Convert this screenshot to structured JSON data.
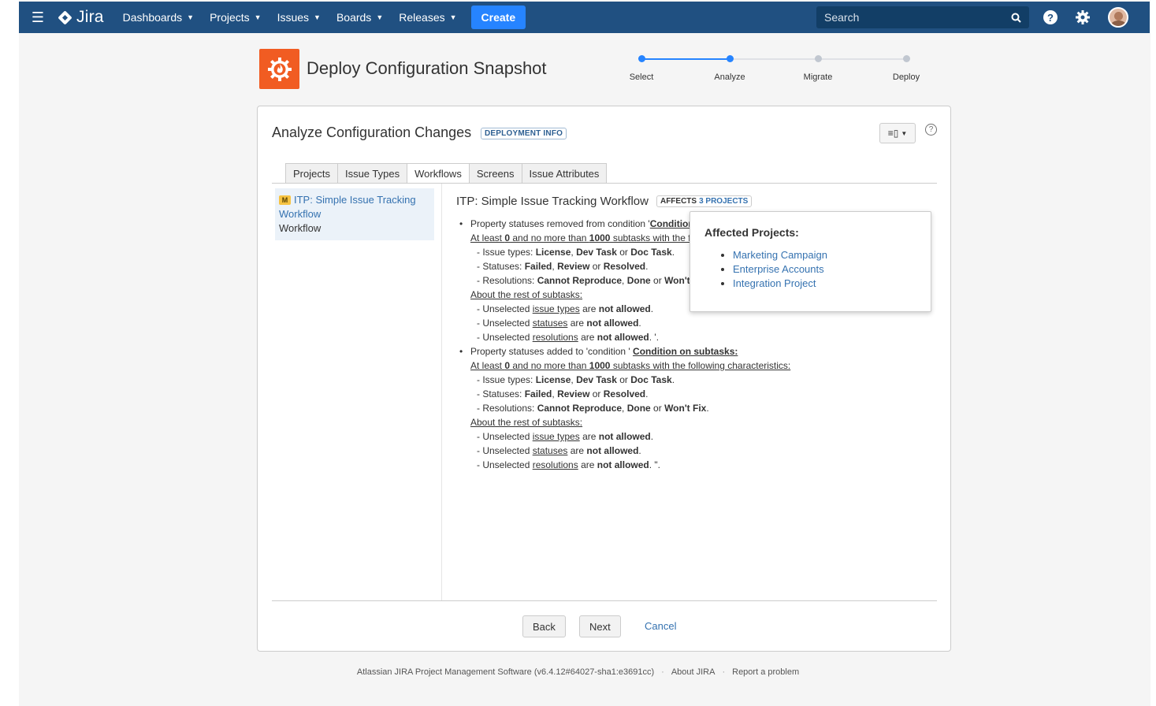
{
  "nav": {
    "logo_text": "Jira",
    "items": [
      {
        "label": "Dashboards"
      },
      {
        "label": "Projects"
      },
      {
        "label": "Issues"
      },
      {
        "label": "Boards"
      },
      {
        "label": "Releases"
      }
    ],
    "create_label": "Create",
    "search_placeholder": "Search"
  },
  "header": {
    "title": "Deploy Configuration Snapshot",
    "steps": [
      "Select",
      "Analyze",
      "Migrate",
      "Deploy"
    ],
    "current_step": 2
  },
  "panel": {
    "title": "Analyze Configuration Changes",
    "badge": "DEPLOYMENT INFO",
    "tabs": [
      "Projects",
      "Issue Types",
      "Workflows",
      "Screens",
      "Issue Attributes"
    ],
    "active_tab": "Workflows",
    "sidebar": {
      "badge": "M",
      "link": "ITP: Simple Issue Tracking Workflow",
      "type": "Workflow"
    },
    "workflow_title": "ITP: Simple Issue Tracking Workflow",
    "affects_label": "AFFECTS",
    "affects_count": "3 PROJECTS",
    "removed": {
      "prefix": "Property statuses removed from condition '",
      "cond": "Condition on subtasks:",
      "atleast_a": "At least ",
      "atleast_min": "0",
      "atleast_b": " and no more than ",
      "atleast_max": "1000",
      "atleast_c": " subtasks with the following characteristics:",
      "issue_types_label": "- Issue types: ",
      "it1": "License",
      "it_sep1": ", ",
      "it2": "Dev Task",
      "it_or": " or ",
      "it3": "Doc Task",
      "it_end": ".",
      "statuses_label": "- Statuses: ",
      "st1": "Failed",
      "st_sep1": ", ",
      "st2": "Review",
      "st_or": " or ",
      "st3": "Resolved",
      "st_end": ".",
      "resolutions_label": "- Resolutions: ",
      "rs1": "Cannot Reproduce",
      "rs_sep1": ", ",
      "rs2": "Done",
      "rs_or": " or ",
      "rs3": "Won't Fix",
      "rs_end": ".",
      "rest_label": "About the rest of subtasks:",
      "u_prefix": "- Unselected ",
      "u_issue_types": "issue types",
      "u_statuses": "statuses",
      "u_resolutions": "resolutions",
      "are": " are ",
      "not_allowed": "not allowed",
      "end1": ".",
      "end_last": ". '."
    },
    "added": {
      "prefix": "Property statuses added to 'condition ' ",
      "end_last": ". \"."
    },
    "buttons": {
      "back": "Back",
      "next": "Next",
      "cancel": "Cancel"
    }
  },
  "popover": {
    "title": "Affected Projects:",
    "projects": [
      "Marketing Campaign",
      "Enterprise Accounts",
      "Integration Project"
    ]
  },
  "footer": {
    "software": "Atlassian JIRA Project Management Software (v6.4.12#64027-sha1:e3691cc)",
    "about": "About JIRA",
    "report": "Report a problem"
  },
  "colors": {
    "nav_bg": "#205081",
    "create_btn": "#2684ff",
    "app_icon": "#f15c22",
    "link": "#3572b0",
    "step_active": "#2684ff",
    "step_inactive": "#c1c7d0"
  }
}
